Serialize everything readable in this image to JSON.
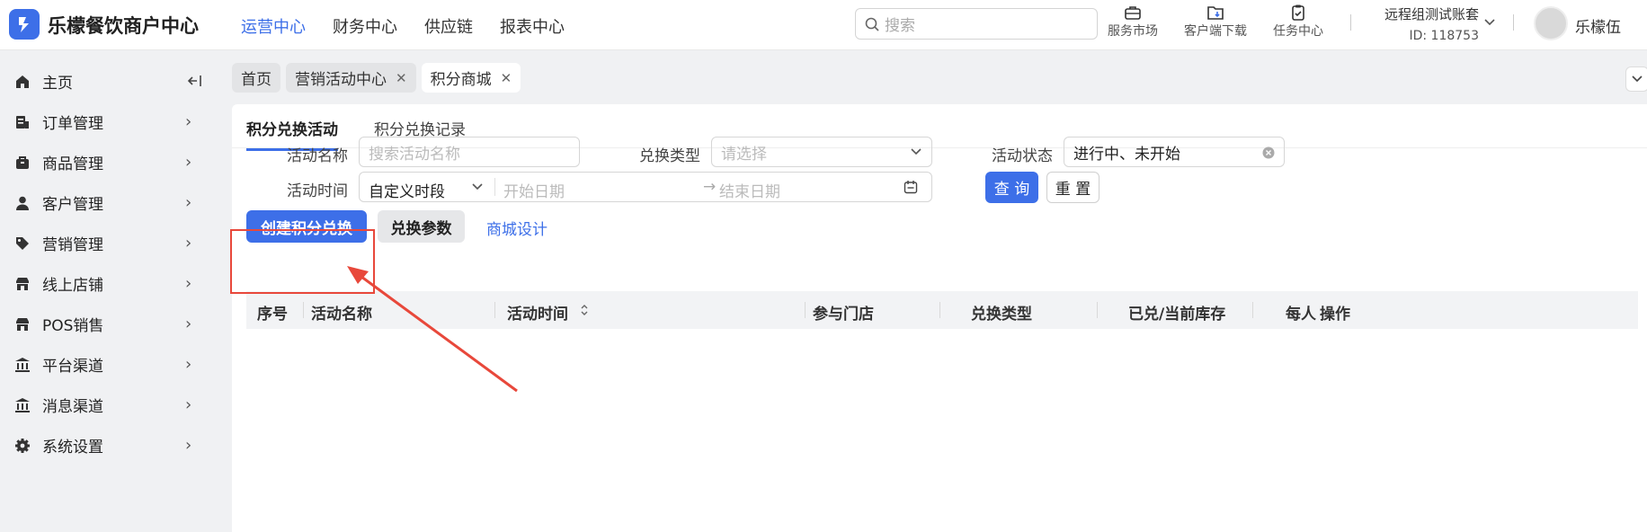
{
  "app": {
    "name": "乐檬餐饮商户中心"
  },
  "nav": [
    {
      "label": "运营中心",
      "active": true
    },
    {
      "label": "财务中心",
      "active": false
    },
    {
      "label": "供应链",
      "active": false
    },
    {
      "label": "报表中心",
      "active": false
    }
  ],
  "search": {
    "placeholder": "搜索"
  },
  "tools": [
    {
      "label": "服务市场",
      "icon": "briefcase-icon"
    },
    {
      "label": "客户端下载",
      "icon": "download-folder-icon"
    },
    {
      "label": "任务中心",
      "icon": "clipboard-check-icon"
    }
  ],
  "account": {
    "name": "远程组测试账套",
    "id": "ID: 118753",
    "user": "乐檬伍"
  },
  "sidebar": [
    {
      "label": "主页",
      "icon": "home-icon"
    },
    {
      "label": "订单管理",
      "icon": "order-icon"
    },
    {
      "label": "商品管理",
      "icon": "goods-icon"
    },
    {
      "label": "客户管理",
      "icon": "user-icon"
    },
    {
      "label": "营销管理",
      "icon": "tag-icon"
    },
    {
      "label": "线上店铺",
      "icon": "store-icon"
    },
    {
      "label": "POS销售",
      "icon": "pos-store-icon"
    },
    {
      "label": "平台渠道",
      "icon": "bank-icon"
    },
    {
      "label": "消息渠道",
      "icon": "bank-icon"
    },
    {
      "label": "系统设置",
      "icon": "gear-icon"
    }
  ],
  "page_tabs": [
    {
      "label": "首页",
      "closable": false
    },
    {
      "label": "营销活动中心",
      "closable": true
    },
    {
      "label": "积分商城",
      "closable": true
    }
  ],
  "subtabs": [
    {
      "label": "积分兑换活动",
      "active": true
    },
    {
      "label": "积分兑换记录",
      "active": false
    }
  ],
  "filters": {
    "name_label": "活动名称",
    "name_placeholder": "搜索活动名称",
    "type_label": "兑换类型",
    "type_placeholder": "请选择",
    "status_label": "活动状态",
    "status_value": "进行中、未开始",
    "time_label": "活动时间",
    "time_mode": "自定义时段",
    "start_placeholder": "开始日期",
    "end_placeholder": "结束日期",
    "query_label": "查 询",
    "reset_label": "重 置"
  },
  "actions": {
    "create_label": "创建积分兑换",
    "params_label": "兑换参数",
    "design_label": "商城设计"
  },
  "table": {
    "columns": [
      "序号",
      "活动名称",
      "活动时间",
      "参与门店",
      "兑换类型",
      "已兑/当前库存",
      "每人",
      "操作"
    ]
  },
  "annotation": {
    "color": "#e8483b"
  }
}
